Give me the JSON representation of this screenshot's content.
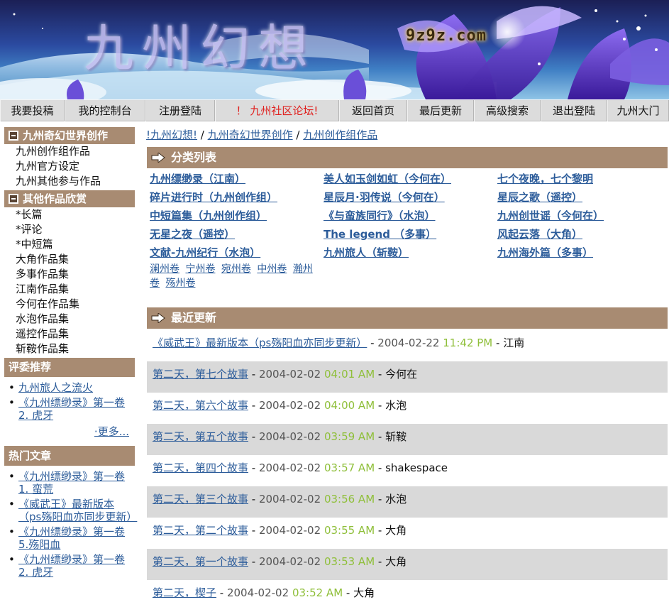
{
  "banner": {
    "title": "九州幻想",
    "url": "9z9z.com"
  },
  "nav": [
    {
      "label": "我要投稿"
    },
    {
      "label": "我的控制台"
    },
    {
      "label": "注册登陆"
    },
    {
      "label": "！ 九州社区论坛!"
    },
    {
      "label": "返回首页"
    },
    {
      "label": "最后更新"
    },
    {
      "label": "高级搜索"
    },
    {
      "label": "退出登陆"
    },
    {
      "label": "九州大门"
    }
  ],
  "sidebar": {
    "section1": {
      "title": "九州奇幻世界创作",
      "links": [
        "九州创作组作品",
        "九州官方设定",
        "九州其他参与作品"
      ]
    },
    "section2": {
      "title": "其他作品欣赏",
      "links": [
        "*长篇",
        "*评论",
        "*中短篇",
        "大角作品集",
        "多事作品集",
        "江南作品集",
        "今何在作品集",
        "水泡作品集",
        "遥控作品集",
        "斩鞍作品集"
      ]
    },
    "recommend": {
      "title": "评委推荐",
      "items": [
        "九州旅人之流火",
        "《九州缥缈录》第一卷 2. 虎牙"
      ],
      "more": "·更多..."
    },
    "hot": {
      "title": "热门文章",
      "items": [
        "《九州缥缈录》第一卷 1. 蛮荒",
        "《威武王》最新版本（ps殇阳血亦同步更新）",
        "《九州缥缈录》第一卷 5.殇阳血",
        "《九州缥缈录》第一卷 2. 虎牙"
      ]
    }
  },
  "breadcrumb": {
    "items": [
      "!九州幻想!",
      "九州奇幻世界创作",
      "九州创作组作品"
    ],
    "sep": " / "
  },
  "categories": {
    "title": "分类列表",
    "col1": [
      "九州缥缈录（江南）",
      "碎片进行时（九州创作组）",
      "中短篇集（九州创作组）",
      "无星之夜（遥控）",
      "文献-九州纪行（水泡）"
    ],
    "col1_subs": [
      "澜州卷",
      "宁州卷",
      "宛州卷",
      "中州卷",
      "瀚州卷",
      "殇州卷"
    ],
    "col2": [
      "美人如玉剑如虹（今何在）",
      "星辰月·羽传说（今何在）",
      "《与蛮族同行》（水泡）",
      "The legend （多事）",
      "九州旅人（斩鞍）"
    ],
    "col3": [
      "七个夜晚，七个黎明",
      "星辰之歌（遥控）",
      "九州创世谣（今何在）",
      "风起云落（大角）",
      "九州海外篇（多事）"
    ]
  },
  "updates": {
    "title": "最近更新",
    "rows": [
      {
        "title": "《威武王》最新版本（ps殇阳血亦同步更新）",
        "date": "2004-02-22",
        "time": "11:42 PM",
        "author": "江南"
      },
      {
        "title": "第二天，第七个故事",
        "date": "2004-02-02",
        "time": "04:01 AM",
        "author": "今何在"
      },
      {
        "title": "第二天，第六个故事",
        "date": "2004-02-02",
        "time": "04:00 AM",
        "author": "水泡"
      },
      {
        "title": "第二天，第五个故事",
        "date": "2004-02-02",
        "time": "03:59 AM",
        "author": "斩鞍"
      },
      {
        "title": "第二天，第四个故事",
        "date": "2004-02-02",
        "time": "03:57 AM",
        "author": "shakespace"
      },
      {
        "title": "第二天，第三个故事",
        "date": "2004-02-02",
        "time": "03:56 AM",
        "author": "水泡"
      },
      {
        "title": "第二天，第二个故事",
        "date": "2004-02-02",
        "time": "03:55 AM",
        "author": "大角"
      },
      {
        "title": "第二天，第一个故事",
        "date": "2004-02-02",
        "time": "03:53 AM",
        "author": "大角"
      },
      {
        "title": "第二天，楔子",
        "date": "2004-02-02",
        "time": "03:52 AM",
        "author": "大角"
      }
    ],
    "dash": " - "
  },
  "colors": {
    "header_brown": "#a88b72",
    "link_blue": "#2c5c9a",
    "time_green": "#8fbf3a",
    "nav_accent": "#e0201e",
    "row_alt": "#d9d9d9"
  },
  "icons": [
    "collapse-box-icon",
    "arrow-right-icon",
    "bullet-icon"
  ]
}
